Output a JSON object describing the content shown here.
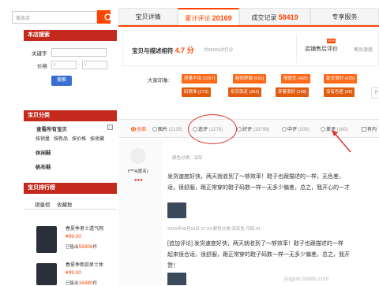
{
  "search": {
    "placeholder": "搜本店"
  },
  "shop_search": {
    "title": "本店搜索",
    "keyword_label": "关键字",
    "price_label": "价格",
    "currency": "¥",
    "button": "搜索"
  },
  "categories": {
    "title": "宝贝分类",
    "all": "查看所有宝贝",
    "sort_links": [
      "按销量",
      "按新品",
      "按价格",
      "按收藏"
    ],
    "items": [
      "休闲鞋",
      "帆布鞋"
    ]
  },
  "ranking": {
    "title": "宝贝排行榜",
    "tabs": [
      "销量榜",
      "收藏数"
    ],
    "products": [
      {
        "name": "春夏季男士透气网",
        "price": "¥99.00",
        "sold_prefix": "已售出",
        "sold": "59306",
        "sold_suffix": "件"
      },
      {
        "name": "春夏季新款男士休",
        "price": "¥99.00",
        "sold_prefix": "已售出",
        "sold": "16480",
        "sold_suffix": "件"
      }
    ]
  },
  "tabs": [
    {
      "label": "宝贝详情",
      "count": ""
    },
    {
      "label": "累计评论",
      "count": "20169"
    },
    {
      "label": "成交记录",
      "count": "58419"
    },
    {
      "label": "专享服务",
      "count": ""
    }
  ],
  "rating": {
    "label": "宝贝与描述相符",
    "score": "4.7 分",
    "raters": "共66069次打分",
    "shop_service": "店铺售后评价",
    "new_badge": "NEW",
    "after_sale": "售后速度"
  },
  "impressions": {
    "label": "大家印象:",
    "tags": [
      "质量不错 (1057)",
      "鞋很舒服 (616)",
      "很便宜 (465)",
      "款式很好 (425)",
      "码很准 (273)",
      "扣完就走 (262)",
      "穿着很好 (148)",
      "没有色差 (58)",
      "开"
    ]
  },
  "filters": {
    "options": [
      {
        "label": "全部",
        "count": "",
        "selected": true
      },
      {
        "label": "图片",
        "count": "(2135)",
        "selected": false
      },
      {
        "label": "追评",
        "count": "(1278)",
        "selected": false
      },
      {
        "label": "好评",
        "count": "(19799)",
        "selected": false
      },
      {
        "label": "中评",
        "count": "(209)",
        "selected": false
      },
      {
        "label": "差评",
        "count": "(160)",
        "selected": false
      },
      {
        "label": "有内",
        "count": "",
        "selected": false
      }
    ]
  },
  "review": {
    "user": "t***4(匿名)",
    "sku": "颜色分类：深灰",
    "line1": "发货速度好快，两天就收到了～够效率！鞋子也跟描述的一样，无色差，",
    "line2": "适，很舒服，跟正常穿的鞋子码数一样一无多少偏差，总之，我开心的一才",
    "date": "2015年05月16日 17:24",
    "meta": "颜色分类:深灰色  尺码:41",
    "followup1": "[追加评论] 发货速度好快，两天就收到了～够效率！鞋子也跟描述的一样",
    "followup2": "起来很合适，很舒服，跟正常穿的鞋子码数一样一无多少偏差，总之，我开",
    "followup3": "赞！"
  },
  "watermark": "jingyan.baidu.com",
  "colors": {
    "accent": "#ff4400",
    "section_header": "#c5281c",
    "tag": "#ff6a1a",
    "annotation": "#e03030",
    "button": "#3b6ed1"
  }
}
